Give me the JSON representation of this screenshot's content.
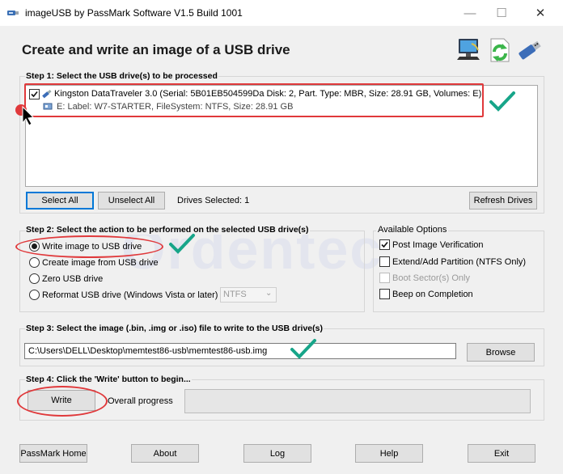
{
  "window": {
    "title": "imageUSB by PassMark Software V1.5 Build 1001",
    "heading": "Create and write an image of a USB drive"
  },
  "step1": {
    "label": "Step 1:  Select the USB drive(s) to be processed",
    "drive": {
      "name": "Kingston DataTraveler 3.0 (Serial: 5B01EB504599Da Disk: 2, Part. Type: MBR, Size: 28.91 GB, Volumes: E)",
      "volume": "E: Label: W7-STARTER, FileSystem: NTFS, Size: 28.91 GB",
      "checked": true
    },
    "select_all": "Select All",
    "unselect_all": "Unselect All",
    "drives_selected": "Drives Selected: 1",
    "refresh": "Refresh Drives"
  },
  "step2": {
    "label": "Step 2: Select the action to be performed on the selected USB drive(s)",
    "actions": [
      {
        "label": "Write image to USB drive",
        "selected": true
      },
      {
        "label": "Create image from USB drive",
        "selected": false
      },
      {
        "label": "Zero USB drive",
        "selected": false
      },
      {
        "label": "Reformat USB drive (Windows Vista or later)",
        "selected": false
      }
    ],
    "format_value": "NTFS"
  },
  "options": {
    "label": "Available Options",
    "items": [
      {
        "label": "Post Image Verification",
        "checked": true,
        "enabled": true
      },
      {
        "label": "Extend/Add Partition (NTFS Only)",
        "checked": false,
        "enabled": true
      },
      {
        "label": "Boot Sector(s) Only",
        "checked": false,
        "enabled": false
      },
      {
        "label": "Beep on Completion",
        "checked": false,
        "enabled": true
      }
    ]
  },
  "step3": {
    "label": "Step 3: Select the image (.bin, .img or .iso) file to write to the USB drive(s)",
    "path": "C:\\Users\\DELL\\Desktop\\memtest86-usb\\memtest86-usb.img",
    "browse": "Browse"
  },
  "step4": {
    "label": "Step 4: Click the 'Write' button to begin...",
    "write": "Write",
    "progress_label": "Overall progress",
    "progress": 0
  },
  "footer": {
    "home": "PassMark Home",
    "about": "About",
    "log": "Log",
    "help": "Help",
    "exit": "Exit"
  },
  "watermark": "Ordentec",
  "colors": {
    "annotation_red": "#e0393b",
    "annotation_green": "#17a589",
    "focus_blue": "#0078d7"
  },
  "icons": [
    "usb-app-icon",
    "computer-icon",
    "refresh-arrows-icon",
    "usb-stick-icon",
    "usb-drive-icon",
    "volume-icon",
    "mouse-cursor-icon",
    "green-checkmark-icon"
  ]
}
